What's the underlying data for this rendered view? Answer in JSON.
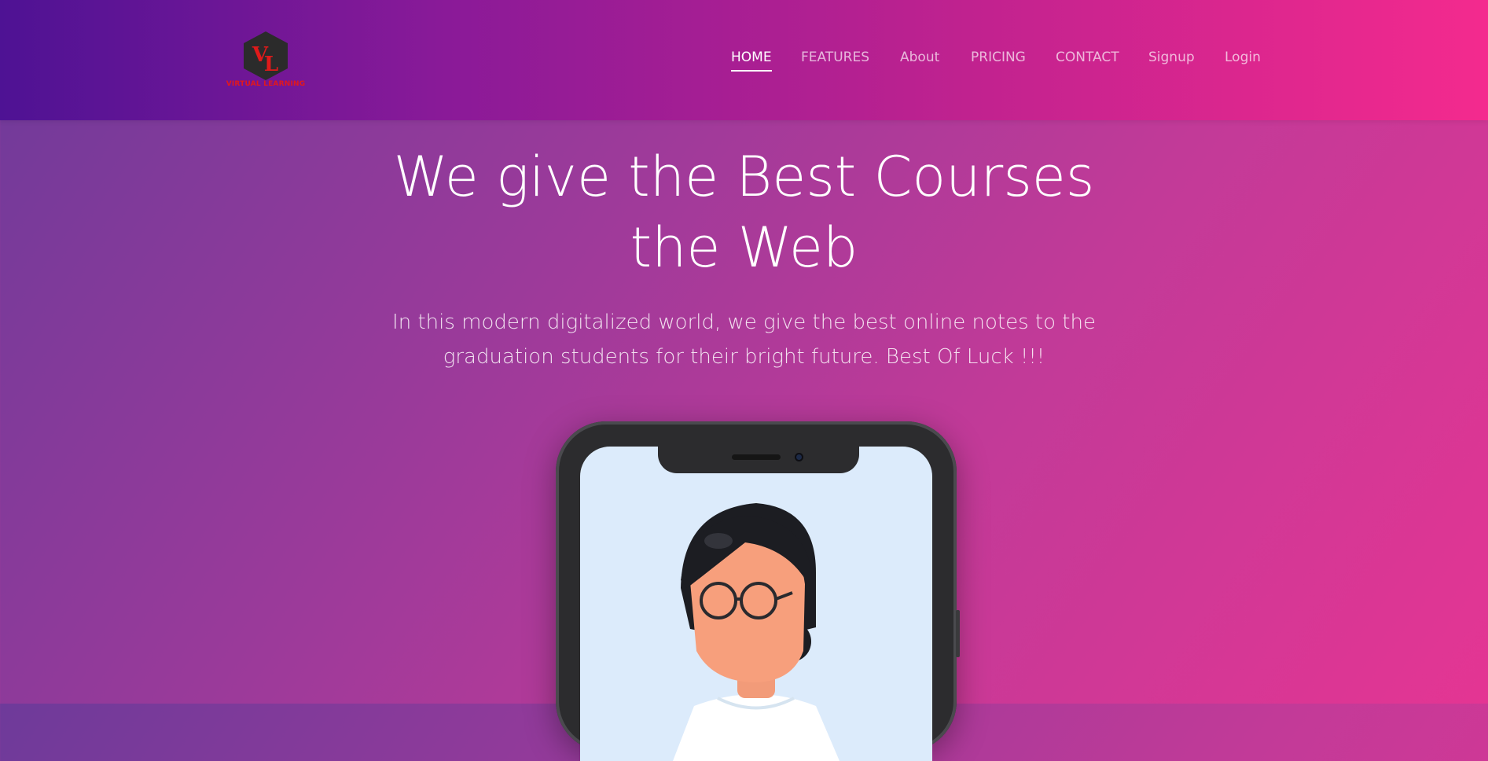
{
  "header": {
    "logo": {
      "letters": "VL",
      "tagline": "VIRTUAL LEARNING",
      "colors": {
        "hexagon": "#2b2b2b",
        "letters": "#e01a1a"
      }
    },
    "nav": [
      {
        "label": "HOME",
        "active": true
      },
      {
        "label": "FEATURES",
        "active": false
      },
      {
        "label": "About",
        "active": false
      },
      {
        "label": "PRICING",
        "active": false
      },
      {
        "label": "CONTACT",
        "active": false
      },
      {
        "label": "Signup",
        "active": false
      },
      {
        "label": "Login",
        "active": false
      }
    ]
  },
  "hero": {
    "title_line1": "We give the Best Courses",
    "title_line2": "the Web",
    "subtitle_line1": "In this modern digitalized world, we give the best online notes to the",
    "subtitle_line2": "graduation students for their bright future. Best Of Luck !!!"
  },
  "illustration": {
    "device": "smartphone",
    "icon": "student-avatar-icon"
  },
  "colors": {
    "nav_gradient_start": "#4e1294",
    "nav_gradient_end": "#f42a8e",
    "hero_gradient_start": "#6e3a9a",
    "hero_gradient_end": "#e43593",
    "text": "#ffffff"
  }
}
